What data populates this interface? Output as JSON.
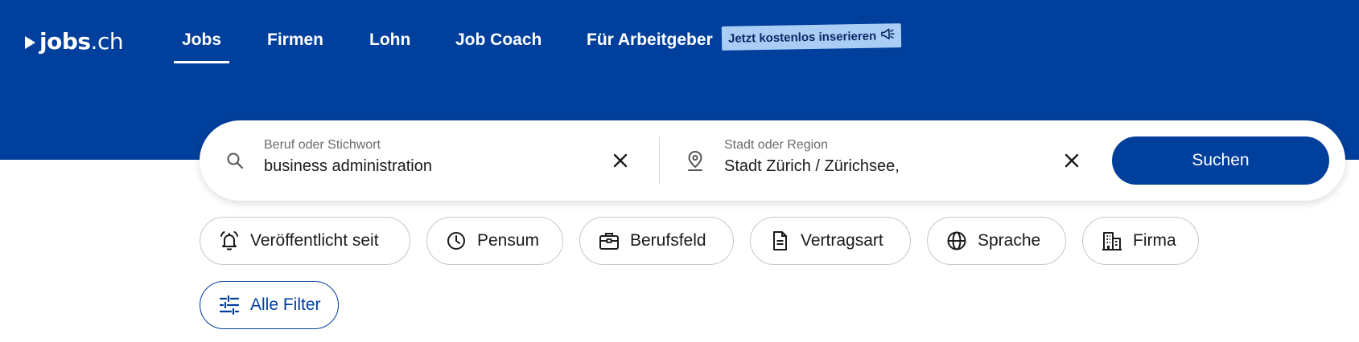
{
  "header": {
    "logo": {
      "name_bold": "jobs",
      "name_suffix": ".ch"
    },
    "nav": [
      {
        "label": "Jobs",
        "active": true
      },
      {
        "label": "Firmen",
        "active": false
      },
      {
        "label": "Lohn",
        "active": false
      },
      {
        "label": "Job Coach",
        "active": false
      },
      {
        "label": "Für Arbeitgeber",
        "active": false
      }
    ],
    "promo": {
      "label": "Jetzt kostenlos inserieren",
      "icon": "megaphone-icon"
    }
  },
  "search": {
    "keyword": {
      "label": "Beruf oder Stichwort",
      "value": "business administration",
      "icon": "search-icon"
    },
    "location": {
      "label": "Stadt oder Region",
      "value": "Stadt Zürich / Zürichsee,",
      "icon": "location-pin-icon"
    },
    "button_label": "Suchen"
  },
  "filters": [
    {
      "label": "Veröffentlicht seit",
      "icon": "bell-icon"
    },
    {
      "label": "Pensum",
      "icon": "clock-icon"
    },
    {
      "label": "Berufsfeld",
      "icon": "briefcase-icon"
    },
    {
      "label": "Vertragsart",
      "icon": "document-icon"
    },
    {
      "label": "Sprache",
      "icon": "globe-icon"
    },
    {
      "label": "Firma",
      "icon": "building-icon"
    }
  ],
  "all_filters": {
    "label": "Alle Filter",
    "icon": "sliders-icon"
  },
  "colors": {
    "brand_blue": "#003f9c",
    "promo_bg": "#a9cdf5",
    "white": "#ffffff"
  }
}
